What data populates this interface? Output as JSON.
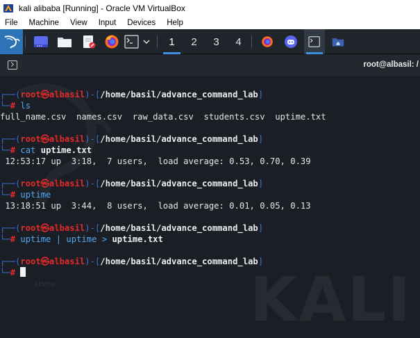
{
  "window": {
    "title": "kali alibaba [Running] - Oracle VM VirtualBox",
    "menu": [
      "File",
      "Machine",
      "View",
      "Input",
      "Devices",
      "Help"
    ]
  },
  "panel": {
    "workspaces": [
      "1",
      "2",
      "3",
      "4"
    ],
    "active_workspace": "1",
    "colors": {
      "panel_bg": "#20252c",
      "accent": "#3b8ee0",
      "kali_blue": "#2c74b7"
    }
  },
  "terminal": {
    "header_title": "root@albasil: /",
    "prompt": {
      "user": "root",
      "at_symbol": "㉿",
      "host": "albasil",
      "path": "/home/basil/advance_command_lab",
      "symbol": "#"
    },
    "colors": {
      "prompt_box": "#3b6fd4",
      "root": "#e32b2b",
      "command": "#50a9f7",
      "bg": "#1b1e24"
    },
    "blocks": [
      {
        "cmd": "ls",
        "args": "",
        "output": "full_name.csv  names.csv  raw_data.csv  students.csv  uptime.txt"
      },
      {
        "cmd": "cat",
        "args": "uptime.txt",
        "output": " 12:53:17 up  3:18,  7 users,  load average: 0.53, 0.70, 0.39"
      },
      {
        "cmd": "uptime",
        "args": "",
        "output": " 13:18:51 up  3:44,  8 users,  load average: 0.01, 0.05, 0.13"
      },
      {
        "cmd": "uptime | uptime >",
        "args": "uptime.txt",
        "output": ""
      }
    ],
    "watermark_text": "KALI",
    "desktop_labels": [
      "Home"
    ]
  }
}
